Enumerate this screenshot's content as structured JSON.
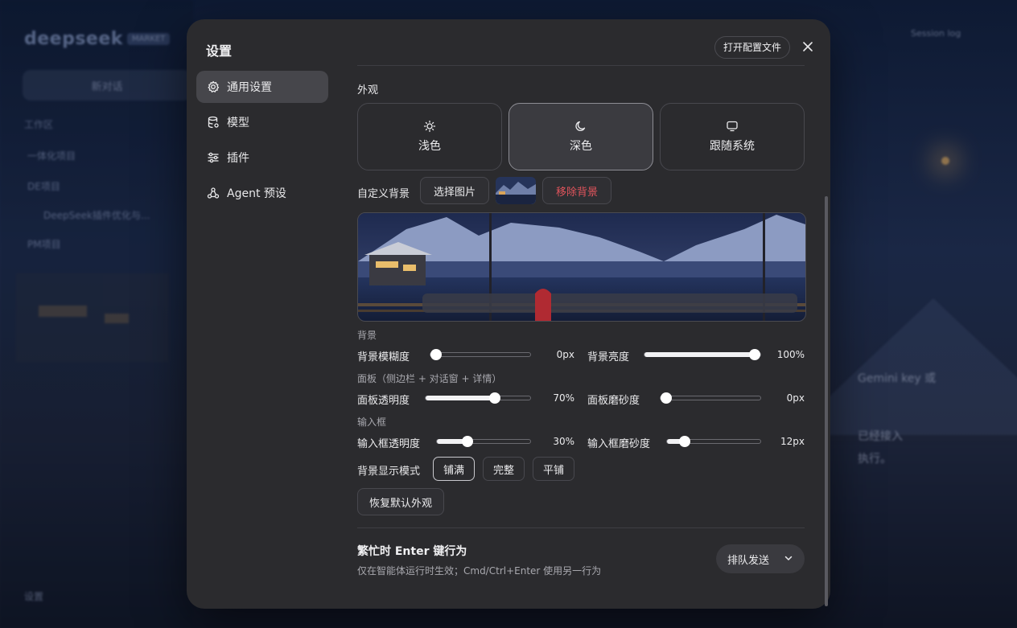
{
  "background_app": {
    "logo": "deepseek",
    "badge": "MARKET",
    "new_chat": "新对话",
    "workspace": "工作区",
    "items": [
      "一体化项目",
      "DE项目",
      "DeepSeek插件优化与...",
      "PM项目"
    ],
    "session_log": "Session log",
    "settings": "设置",
    "snippets": [
      "Gemini key 或",
      "已经接入",
      "执行。"
    ]
  },
  "modal": {
    "title": "设置",
    "open_config_label": "打开配置文件",
    "nav": [
      {
        "label": "通用设置",
        "icon": "gear-icon",
        "active": true
      },
      {
        "label": "模型",
        "icon": "database-icon",
        "active": false
      },
      {
        "label": "插件",
        "icon": "sliders-icon",
        "active": false
      },
      {
        "label": "Agent 预设",
        "icon": "agent-icon",
        "active": false
      }
    ]
  },
  "appearance": {
    "heading": "外观",
    "themes": [
      {
        "label": "浅色",
        "icon": "sun-icon",
        "selected": false
      },
      {
        "label": "深色",
        "icon": "moon-icon",
        "selected": true
      },
      {
        "label": "跟随系统",
        "icon": "monitor-icon",
        "selected": false
      }
    ],
    "custom_bg_label": "自定义背景",
    "choose_image_label": "选择图片",
    "remove_bg_label": "移除背景",
    "bg_section": "背景",
    "panel_section": "面板（侧边栏 + 对话窗 + 详情）",
    "input_section": "输入框",
    "sliders": {
      "bg_blur": {
        "label": "背景模糊度",
        "value_text": "0px",
        "fraction": 0.0
      },
      "bg_brightness": {
        "label": "背景亮度",
        "value_text": "100%",
        "fraction": 1.0
      },
      "panel_opacity": {
        "label": "面板透明度",
        "value_text": "70%",
        "fraction": 0.68
      },
      "panel_frost": {
        "label": "面板磨砂度",
        "value_text": "0px",
        "fraction": 0.0
      },
      "input_opacity": {
        "label": "输入框透明度",
        "value_text": "30%",
        "fraction": 0.3
      },
      "input_frost": {
        "label": "输入框磨砂度",
        "value_text": "12px",
        "fraction": 0.15
      }
    },
    "display_mode_label": "背景显示模式",
    "display_modes": [
      {
        "label": "铺满",
        "selected": true
      },
      {
        "label": "完整",
        "selected": false
      },
      {
        "label": "平铺",
        "selected": false
      }
    ],
    "reset_label": "恢复默认外观"
  },
  "enter_behavior": {
    "title": "繁忙时 Enter 键行为",
    "description": "仅在智能体运行时生效；Cmd/Ctrl+Enter 使用另一行为",
    "selected": "排队发送"
  },
  "colors": {
    "modal_bg": "#2b2b2e",
    "danger": "#e0545c",
    "selected_card": "#3b3b40"
  }
}
